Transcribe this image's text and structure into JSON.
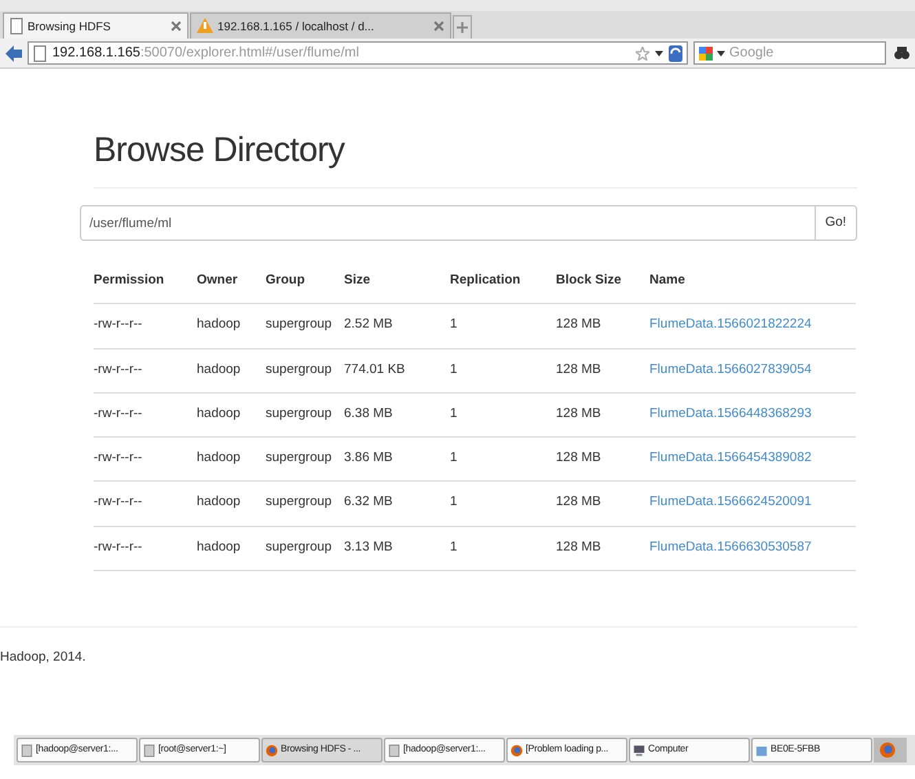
{
  "browser": {
    "tabs": [
      {
        "title": "Browsing HDFS",
        "selected": true,
        "kind": "page"
      },
      {
        "title": "192.168.1.165 / localhost / d...",
        "selected": false,
        "kind": "warning"
      }
    ],
    "address": {
      "host": "192.168.1.165",
      "rest": ":50070/explorer.html#/user/flume/ml"
    },
    "search": {
      "placeholder": "Google"
    }
  },
  "page": {
    "title": "Browse Directory",
    "path": "/user/flume/ml",
    "go": "Go!",
    "table": {
      "columns": [
        "Permission",
        "Owner",
        "Group",
        "Size",
        "Replication",
        "Block Size",
        "Name"
      ],
      "rows": [
        [
          "-rw-r--r--",
          "hadoop",
          "supergroup",
          "2.52 MB",
          "1",
          "128 MB",
          "FlumeData.1566021822224"
        ],
        [
          "-rw-r--r--",
          "hadoop",
          "supergroup",
          "774.01 KB",
          "1",
          "128 MB",
          "FlumeData.1566027839054"
        ],
        [
          "-rw-r--r--",
          "hadoop",
          "supergroup",
          "6.38 MB",
          "1",
          "128 MB",
          "FlumeData.1566448368293"
        ],
        [
          "-rw-r--r--",
          "hadoop",
          "supergroup",
          "3.86 MB",
          "1",
          "128 MB",
          "FlumeData.1566454389082"
        ],
        [
          "-rw-r--r--",
          "hadoop",
          "supergroup",
          "6.32 MB",
          "1",
          "128 MB",
          "FlumeData.1566624520091"
        ],
        [
          "-rw-r--r--",
          "hadoop",
          "supergroup",
          "3.13 MB",
          "1",
          "128 MB",
          "FlumeData.1566630530587"
        ]
      ]
    },
    "footer": "Hadoop, 2014."
  },
  "taskbar": [
    {
      "label": "[hadoop@server1:...",
      "kind": "terminal",
      "selected": false
    },
    {
      "label": "[root@server1:~]",
      "kind": "terminal",
      "selected": false
    },
    {
      "label": "Browsing HDFS - ...",
      "kind": "browser",
      "selected": true
    },
    {
      "label": "[hadoop@server1:...",
      "kind": "terminal",
      "selected": false
    },
    {
      "label": "[Problem loading p...",
      "kind": "browser",
      "selected": false
    },
    {
      "label": "Computer",
      "kind": "computer",
      "selected": false
    },
    {
      "label": "BE0E-5FBB",
      "kind": "drive",
      "selected": false
    }
  ]
}
